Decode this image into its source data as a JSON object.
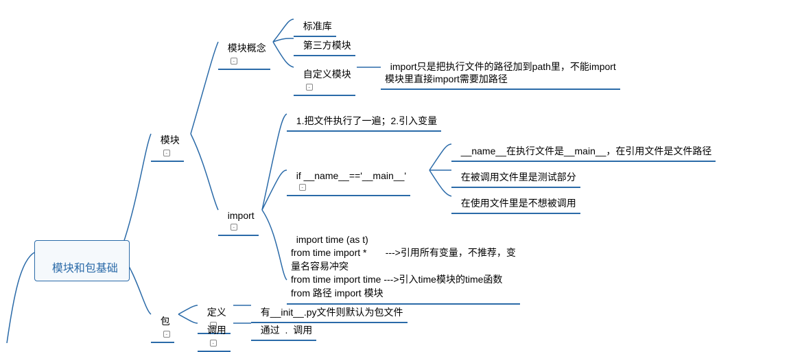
{
  "root": {
    "label": "模块和包基础"
  },
  "module": {
    "label": "模块",
    "concept": {
      "label": "模块概念",
      "std": "标准库",
      "third": "第三方模块",
      "custom": {
        "label": "自定义模块",
        "note": "import只是把执行文件的路径加到path里，不能import\n模块里直接import需要加路径"
      }
    },
    "import": {
      "label": "import",
      "effect": "1.把文件执行了一遍；2.引入变量",
      "nametest": {
        "cond": "if __name__=='__main__'",
        "a": "__name__在执行文件是__main__，在引用文件是文件路径",
        "b": "在被调用文件里是测试部分",
        "c": "在使用文件里是不想被调用"
      },
      "syntax": "import time (as t)\nfrom time import *       --->引用所有变量，不推荐，变\n量名容易冲突\nfrom time import time --->引入time模块的time函数\nfrom 路径 import 模块"
    }
  },
  "package": {
    "label": "包",
    "def": {
      "label": "定义",
      "text": "有__init__.py文件则默认为包文件"
    },
    "call": {
      "label": "调用",
      "text": "通过  .  调用"
    }
  },
  "toggle_symbol": "-"
}
